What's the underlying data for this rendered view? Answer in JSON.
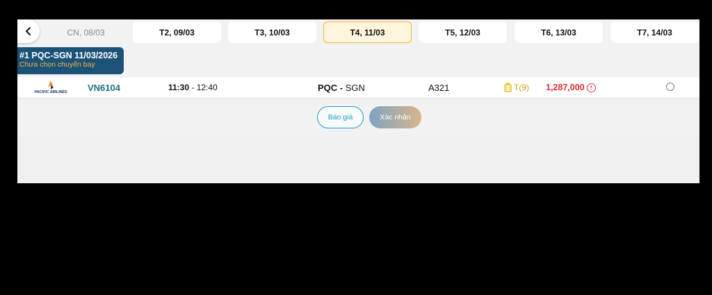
{
  "date_bar": {
    "back_icon": "chevron-left-icon",
    "dates": [
      {
        "label": "CN, 08/03",
        "state": "disabled"
      },
      {
        "label": "T2, 09/03",
        "state": "normal"
      },
      {
        "label": "T3, 10/03",
        "state": "normal"
      },
      {
        "label": "T4, 11/03",
        "state": "active"
      },
      {
        "label": "T5, 12/03",
        "state": "normal"
      },
      {
        "label": "T6, 13/03",
        "state": "normal"
      },
      {
        "label": "T7, 14/03",
        "state": "normal"
      }
    ]
  },
  "leg": {
    "title": "#1 PQC-SGN 11/03/2026",
    "status": "Chưa chọn chuyến bay"
  },
  "flight": {
    "airline_logo": "PACIFIC AIRLINES",
    "flight_no": "VN6104",
    "depart_time": "11:30",
    "time_sep": " - ",
    "arrive_time": "12:40",
    "origin": "PQC",
    "route_sep": " - ",
    "destination": "SGN",
    "aircraft": "A321",
    "fare_class": "T(9)",
    "price": "1,287,000",
    "price_info_glyph": "!"
  },
  "actions": {
    "quote_label": "Báo giá",
    "confirm_label": "Xác nhận"
  },
  "colors": {
    "accent_teal": "#1d6f84",
    "badge_bg": "#1c5278",
    "status_orange": "#f4b53c",
    "price_red": "#e02d36",
    "active_tab_border": "#f0b733"
  }
}
